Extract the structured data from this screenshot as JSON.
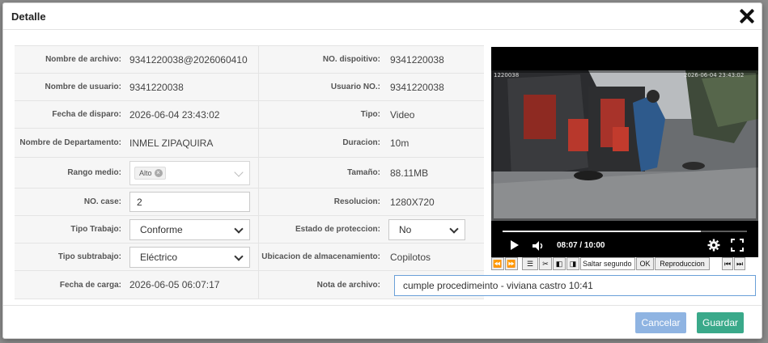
{
  "modal": {
    "title": "Detalle"
  },
  "fields": {
    "file_name": {
      "label": "Nombre de archivo:",
      "value": "9341220038@2026060410"
    },
    "device_no": {
      "label": "NO. dispoitivo:",
      "value": "9341220038"
    },
    "user_name": {
      "label": "Nombre de usuario:",
      "value": "9341220038"
    },
    "user_no": {
      "label": "Usuario NO.:",
      "value": "9341220038"
    },
    "trigger_date": {
      "label": "Fecha de disparo:",
      "value": "2026-06-04 23:43:02"
    },
    "type": {
      "label": "Tipo:",
      "value": "Video"
    },
    "department": {
      "label": "Nombre de Departamento:",
      "value": "INMEL ZIPAQUIRA"
    },
    "duration": {
      "label": "Duracion:",
      "value": "10m"
    },
    "range": {
      "label": "Rango medio:",
      "value": "Alto"
    },
    "size": {
      "label": "Tamaño:",
      "value": "88.11MB"
    },
    "case_no": {
      "label": "NO. case:",
      "value": "2"
    },
    "resolution": {
      "label": "Resolucion:",
      "value": "1280X720"
    },
    "work_type": {
      "label": "Tipo Trabajo:",
      "value": "Conforme"
    },
    "protection": {
      "label": "Estado de proteccion:",
      "value": "No"
    },
    "work_subtype": {
      "label": "Tipo subtrabajo:",
      "value": "Eléctrico"
    },
    "storage": {
      "label": "Ubicacion de almacenamiento:",
      "value": "Copilotos"
    },
    "upload_date": {
      "label": "Fecha de carga:",
      "value": "2026-06-05 06:07:17"
    },
    "note": {
      "label": "Nota de archivo:",
      "value": "cumple procedimeinto - viviana castro 10:41"
    }
  },
  "video": {
    "time": "08:07 / 10:00",
    "progress": 0.81,
    "osd_left": "1220038",
    "osd_right": "2026-06-04 23:43:02",
    "controls": {
      "skip_placeholder": "Saltar segundo",
      "ok": "OK",
      "playback": "Reproduccion"
    }
  },
  "footer": {
    "cancel": "Cancelar",
    "save": "Guardar"
  },
  "colors": {
    "cancel": "#8fb4e2",
    "save": "#3aa98a",
    "focus_border": "#6aa0d8"
  }
}
